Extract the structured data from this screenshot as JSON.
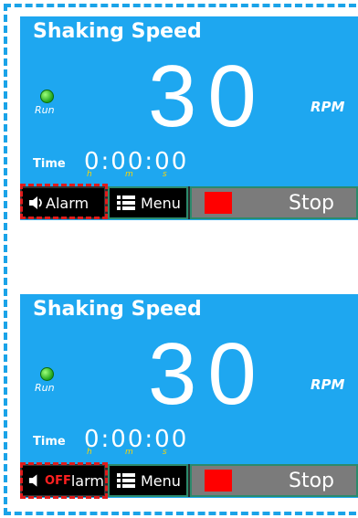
{
  "panels": [
    {
      "title": "Shaking Speed",
      "run_label": "Run",
      "speed": "30",
      "rpm_label": "RPM",
      "time_label": "Time",
      "time_value": "0:00:00",
      "unit_h": "h",
      "unit_m": "m",
      "unit_s": "s",
      "alarm_label": "Alarm",
      "alarm_off_text": "",
      "menu_label": "Menu",
      "stop_label": "Stop"
    },
    {
      "title": "Shaking Speed",
      "run_label": "Run",
      "speed": "30",
      "rpm_label": "RPM",
      "time_label": "Time",
      "time_value": "0:00:00",
      "unit_h": "h",
      "unit_m": "m",
      "unit_s": "s",
      "alarm_label": "larm",
      "alarm_off_text": "OFF",
      "menu_label": "Menu",
      "stop_label": "Stop"
    }
  ],
  "colors": {
    "panel_bg": "#1ea7f0",
    "frame_dash": "#1aa3e8",
    "highlight_dash": "#e01b1b",
    "stop_square": "#ff0000",
    "run_led": "#1fa31a"
  },
  "icons": {
    "alarm": "speaker-icon",
    "menu": "list-icon",
    "stop": "stop-square-icon",
    "run": "led-icon"
  }
}
